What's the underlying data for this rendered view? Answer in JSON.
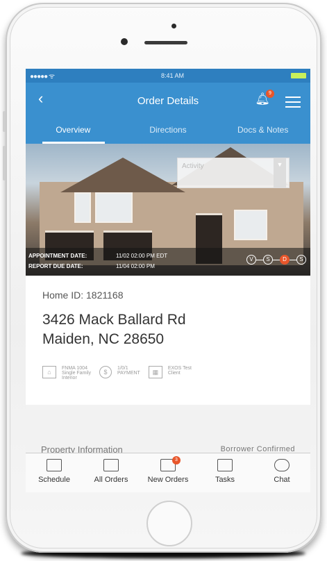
{
  "statusbar": {
    "signal": "●●●●● ᯤ",
    "time": "8:41 AM"
  },
  "navbar": {
    "back_glyph": "‹",
    "title": "Order Details",
    "notification_count": "9"
  },
  "tabs": [
    {
      "label": "Overview",
      "active": true
    },
    {
      "label": "Directions",
      "active": false
    },
    {
      "label": "Docs & Notes",
      "active": false
    }
  ],
  "hero": {
    "dropdown_placeholder": "Activity",
    "appointment_label": "APPOINTMENT DATE:",
    "appointment_value": "11/02 02:00 PM EDT",
    "report_label": "REPORT DUE DATE:",
    "report_value": "11/04 02:00 PM",
    "steps": [
      "V",
      "S",
      "D",
      "S"
    ]
  },
  "details": {
    "home_id": "Home ID: 1821168",
    "address_line1": "3426 Mack Ballard Rd",
    "address_line2": "Maiden, NC 28650",
    "meta": [
      {
        "icon": "home-icon",
        "text": "FNMA 1004\nSingle Family\nInterior"
      },
      {
        "icon": "dollar-icon",
        "text": "1/0/1\nPAYMENT"
      },
      {
        "icon": "building-icon",
        "text": "EXOS Test\nClient"
      }
    ]
  },
  "property": {
    "left": "Property Information",
    "right": "Borrower Confirmed"
  },
  "bottom_nav": [
    {
      "label": "Schedule",
      "icon": "calendar-icon"
    },
    {
      "label": "All Orders",
      "icon": "folder-icon"
    },
    {
      "label": "New Orders",
      "icon": "inbox-icon",
      "badge": "3"
    },
    {
      "label": "Tasks",
      "icon": "clipboard-icon"
    },
    {
      "label": "Chat",
      "icon": "chat-icon"
    }
  ],
  "colors": {
    "primary": "#3a90cf",
    "accent": "#e8562b"
  }
}
